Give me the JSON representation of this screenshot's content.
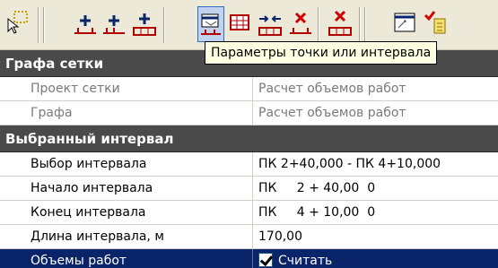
{
  "tooltip": "Параметры точки или интервала",
  "toolbar": {
    "icons": [
      "select-area-icon",
      "add-point-icon",
      "add-point-alt-icon",
      "add-interval-icon",
      "point-params-icon",
      "table-icon",
      "split-interval-icon",
      "delete-point-icon",
      "delete-interval-icon",
      "properties-icon",
      "edit-note-icon"
    ]
  },
  "sections": [
    {
      "title": "Графа сетки",
      "rows": [
        {
          "label": "Проект сетки",
          "value": "Расчет объемов работ"
        },
        {
          "label": "Графа",
          "value": "Расчет объемов работ"
        }
      ]
    },
    {
      "title": "Выбранный интервал",
      "rows": [
        {
          "label": "Выбор интервала",
          "value": "ПК 2+40,000 - ПК 4+10,000"
        },
        {
          "label": "Начало интервала",
          "value": "ПК     2 + 40,00  0"
        },
        {
          "label": "Конец интервала",
          "value": "ПК     4 + 10,00  0"
        },
        {
          "label": "Длина интервала, м",
          "value": "170,00"
        },
        {
          "label": "Объемы работ",
          "value": "Считать",
          "checked": true
        }
      ]
    }
  ]
}
